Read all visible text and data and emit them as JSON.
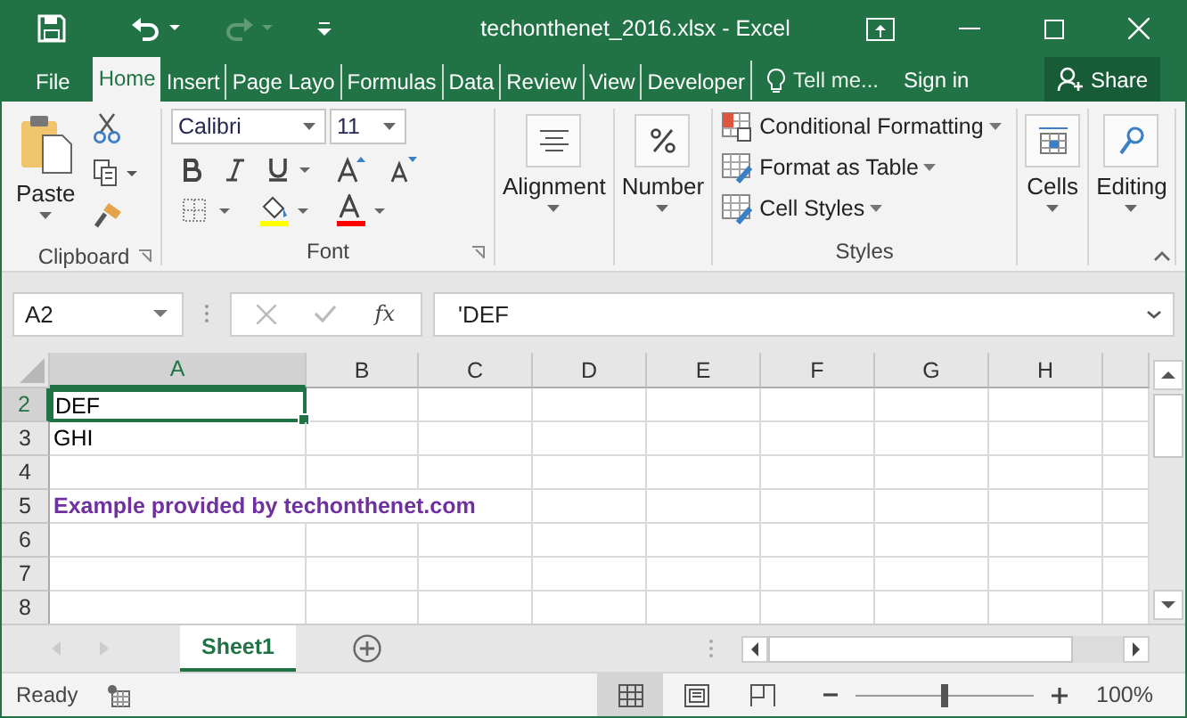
{
  "window": {
    "title": "techonthenet_2016.xlsx - Excel"
  },
  "ribbon_tabs": [
    {
      "label": "File",
      "selected": false
    },
    {
      "label": "Home",
      "selected": true
    },
    {
      "label": "Insert",
      "selected": false
    },
    {
      "label": "Page Layo",
      "selected": false
    },
    {
      "label": "Formulas",
      "selected": false
    },
    {
      "label": "Data",
      "selected": false
    },
    {
      "label": "Review",
      "selected": false
    },
    {
      "label": "View",
      "selected": false
    },
    {
      "label": "Developer",
      "selected": false
    }
  ],
  "tell_me": {
    "placeholder": "Tell me..."
  },
  "sign_in": "Sign in",
  "share": "Share",
  "ribbon": {
    "clipboard": {
      "paste": "Paste",
      "label": "Clipboard"
    },
    "font": {
      "name": "Calibri",
      "size": "11",
      "label": "Font"
    },
    "alignment": "Alignment",
    "number": "Number",
    "styles": {
      "items": [
        "Conditional Formatting",
        "Format as Table",
        "Cell Styles"
      ],
      "label": "Styles"
    },
    "cells": "Cells",
    "editing": "Editing"
  },
  "name_box": "A2",
  "fx": "fx",
  "formula": "'DEF",
  "columns": [
    {
      "label": "A",
      "selected": true
    },
    {
      "label": "B",
      "selected": false
    },
    {
      "label": "C",
      "selected": false
    },
    {
      "label": "D",
      "selected": false
    },
    {
      "label": "E",
      "selected": false
    },
    {
      "label": "F",
      "selected": false
    },
    {
      "label": "G",
      "selected": false
    },
    {
      "label": "H",
      "selected": false
    }
  ],
  "rows": [
    {
      "label": "2",
      "cell_a": {
        "text": "DEF",
        "selected": true,
        "bold": false,
        "color": "#000000"
      }
    },
    {
      "label": "3",
      "cell_a": {
        "text": "GHI",
        "selected": false,
        "bold": false,
        "color": "#000000"
      }
    },
    {
      "label": "4"
    },
    {
      "label": "5",
      "cell_a": {
        "text": "Example provided by techonthenet.com",
        "selected": false,
        "bold": true,
        "color": "#7030a0"
      }
    },
    {
      "label": "6"
    },
    {
      "label": "7"
    },
    {
      "label": "8"
    }
  ],
  "sheet_tabs": [
    {
      "label": "Sheet1",
      "selected": true
    }
  ],
  "status_bar": {
    "status": "Ready",
    "views": [
      {
        "kind": "normal",
        "selected": true
      },
      {
        "kind": "page-layout",
        "selected": false
      },
      {
        "kind": "page-break",
        "selected": false
      }
    ],
    "zoom_slider": {
      "level": 0.5
    },
    "zoom": "100%"
  }
}
